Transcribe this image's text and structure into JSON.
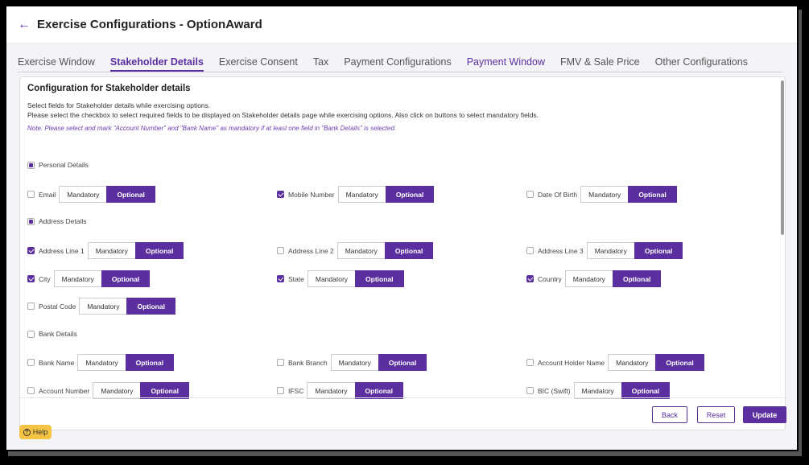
{
  "header": {
    "title": "Exercise Configurations - OptionAward"
  },
  "tabs": [
    {
      "label": "Exercise Window"
    },
    {
      "label": "Stakeholder Details"
    },
    {
      "label": "Exercise Consent"
    },
    {
      "label": "Tax"
    },
    {
      "label": "Payment Configurations"
    },
    {
      "label": "Payment Window"
    },
    {
      "label": "FMV & Sale Price"
    },
    {
      "label": "Other Configurations"
    }
  ],
  "config": {
    "title": "Configuration for Stakeholder details",
    "desc1": "Select fields for Stakeholder details while exercising options.",
    "desc2": "Please select the checkbox to select required fields to be displayed on Stakeholder details page while exercising options. Also click on buttons to select mandatory fields.",
    "note": "Note: Please select and mark \"Account Number\" and \"Bank Name\" as mandatory if at least one field in \"Bank Details\" is selected."
  },
  "toggle": {
    "mandatory": "Mandatory",
    "optional": "Optional"
  },
  "sections": {
    "personal": {
      "label": "Personal Details",
      "state": "partial"
    },
    "address": {
      "label": "Address Details",
      "state": "partial"
    },
    "bank": {
      "label": "Bank Details",
      "state": "unchecked"
    }
  },
  "fields": {
    "email": {
      "label": "Email",
      "checked": false,
      "selected": "Optional"
    },
    "mobile": {
      "label": "Mobile Number",
      "checked": true,
      "selected": "Optional"
    },
    "dob": {
      "label": "Date Of Birth",
      "checked": false,
      "selected": "Optional"
    },
    "addr1": {
      "label": "Address Line 1",
      "checked": true,
      "selected": "Optional"
    },
    "addr2": {
      "label": "Address Line 2",
      "checked": false,
      "selected": "Optional"
    },
    "addr3": {
      "label": "Address Line 3",
      "checked": false,
      "selected": "Optional"
    },
    "city": {
      "label": "City",
      "checked": true,
      "selected": "Optional"
    },
    "state": {
      "label": "State",
      "checked": true,
      "selected": "Optional"
    },
    "country": {
      "label": "Country",
      "checked": true,
      "selected": "Optional"
    },
    "postal": {
      "label": "Postal Code",
      "checked": false,
      "selected": "Optional"
    },
    "bankName": {
      "label": "Bank Name",
      "checked": false,
      "selected": "Optional"
    },
    "bankBranch": {
      "label": "Bank Branch",
      "checked": false,
      "selected": "Optional"
    },
    "holder": {
      "label": "Account Holder Name",
      "checked": false,
      "selected": "Optional"
    },
    "accNum": {
      "label": "Account Number",
      "checked": false,
      "selected": "Optional"
    },
    "ifsc": {
      "label": "IFSC",
      "checked": false,
      "selected": "Optional"
    },
    "bic": {
      "label": "BIC (Swift)",
      "checked": false,
      "selected": "Optional"
    }
  },
  "footer": {
    "back": "Back",
    "reset": "Reset",
    "update": "Update"
  },
  "help": {
    "label": "Help"
  },
  "colors": {
    "accent": "#5b2fa0",
    "help": "#f4c343"
  }
}
